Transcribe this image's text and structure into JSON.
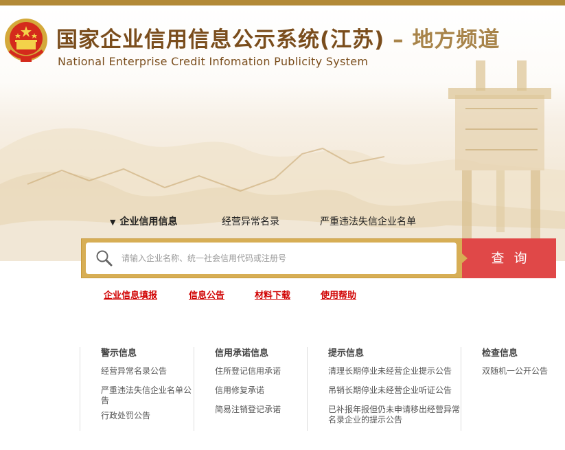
{
  "header": {
    "title_main": "国家企业信用信息公示系统(江苏)",
    "title_sep": " – ",
    "title_sub": "地方频道",
    "title_en": "National Enterprise Credit Infomation Publicity System",
    "emblem_icon": "national-emblem-icon"
  },
  "tabs": [
    {
      "label": "企业信用信息",
      "active": true
    },
    {
      "label": "经营异常名录",
      "active": false
    },
    {
      "label": "严重违法失信企业名单",
      "active": false
    }
  ],
  "search": {
    "placeholder": "请输入企业名称、统一社会信用代码或注册号",
    "button_label": "查询",
    "icon": "search-icon"
  },
  "links": [
    {
      "label": "企业信息填报"
    },
    {
      "label": "信息公告"
    },
    {
      "label": "材料下载"
    },
    {
      "label": "使用帮助"
    }
  ],
  "columns": [
    {
      "title": "警示信息",
      "items": [
        "经营异常名录公告",
        "严重违法失信企业名单公告",
        "行政处罚公告"
      ]
    },
    {
      "title": "信用承诺信息",
      "items": [
        "住所登记信用承诺",
        "信用修复承诺",
        "简易注销登记承诺"
      ]
    },
    {
      "title": "提示信息",
      "items": [
        "清理长期停业未经营企业提示公告",
        "吊销长期停业未经营企业听证公告",
        "已补报年报但仍未申请移出经营异常名录企业的提示公告"
      ]
    },
    {
      "title": "检查信息",
      "items": [
        "双随机一公开公告"
      ]
    }
  ],
  "colors": {
    "brand_brown": "#7a4d1c",
    "gold": "#d7ae55",
    "search_red": "#e04848",
    "link_red": "#d00000"
  }
}
